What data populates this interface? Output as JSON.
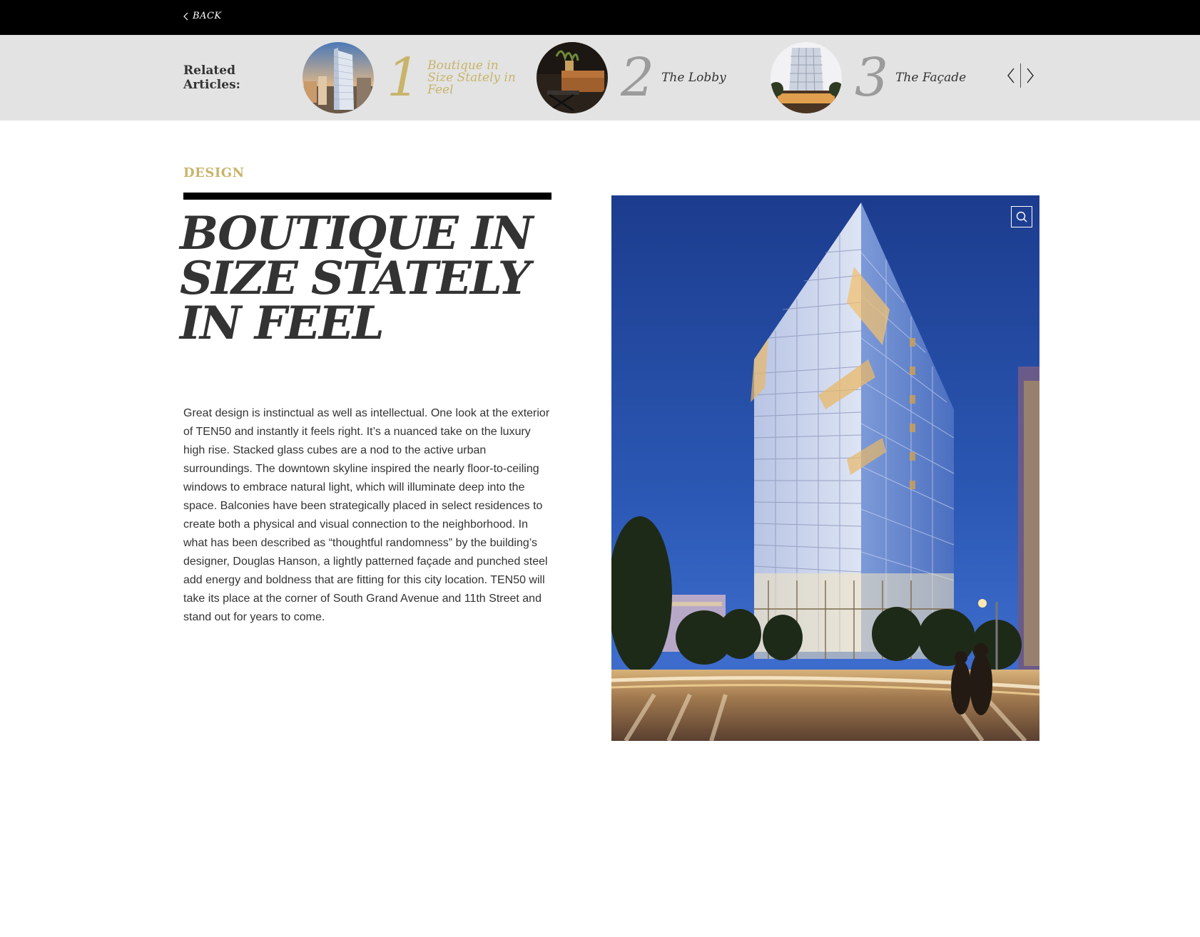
{
  "topbar": {
    "back_label": "BACK"
  },
  "related": {
    "heading": "Related Articles:",
    "items": [
      {
        "number": "1",
        "title": "Boutique in Size Stately in Feel",
        "active": true,
        "thumb_icon": "tower-photo"
      },
      {
        "number": "2",
        "title": "The Lobby",
        "active": false,
        "thumb_icon": "lobby-photo"
      },
      {
        "number": "3",
        "title": "The Façade",
        "active": false,
        "thumb_icon": "facade-photo"
      }
    ],
    "prev_icon": "chevron-left-icon",
    "next_icon": "chevron-right-icon"
  },
  "article": {
    "category": "DESIGN",
    "headline": "BOUTIQUE IN SIZE STATELY IN FEEL",
    "body": "Great design is instinctual as well as intellectual. One look at the exterior of TEN50 and instantly it feels right. It’s a nuanced take on the luxury high rise. Stacked glass cubes are a nod to the active urban surroundings. The downtown skyline inspired the nearly floor-to-ceiling windows to embrace natural light, which will illuminate deep into the space. Balconies have been strategically placed in select residences to create both a physical and visual connection to the neighborhood. In what has been described as “thoughtful randomness” by the building’s designer, Douglas Hanson, a lightly patterned façade and punched steel add energy and boldness that are fitting for this city location. TEN50 will take its place at the corner of South Grand Avenue and 11th Street and stand out for years to come.",
    "hero_icon": "building-photo",
    "zoom_icon": "magnifier-icon"
  },
  "colors": {
    "accent_gold": "#c8b46a",
    "topbar": "#000000",
    "related_bg": "#e3e3e3",
    "text": "#333333"
  }
}
